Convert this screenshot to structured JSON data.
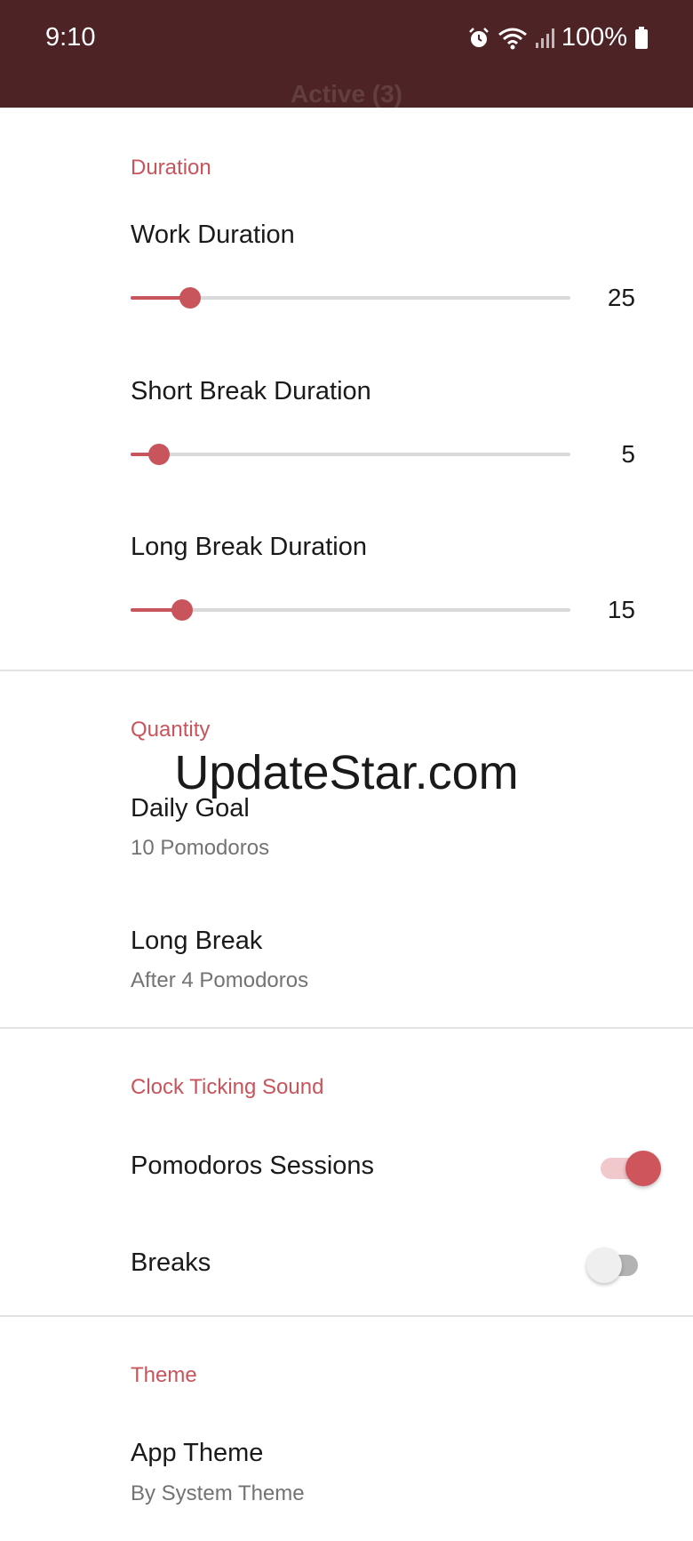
{
  "status_bar": {
    "time": "9:10",
    "battery": "100%"
  },
  "behind_title": "Active (3)",
  "duration": {
    "section_title": "Duration",
    "work": {
      "label": "Work Duration",
      "value": "25",
      "fraction": 0.135
    },
    "short_break": {
      "label": "Short Break Duration",
      "value": "5",
      "fraction": 0.065
    },
    "long_break": {
      "label": "Long Break Duration",
      "value": "15",
      "fraction": 0.118
    }
  },
  "quantity": {
    "section_title": "Quantity",
    "daily_goal": {
      "title": "Daily Goal",
      "summary": "10 Pomodoros"
    },
    "long_break": {
      "title": "Long Break",
      "summary": "After 4 Pomodoros"
    }
  },
  "watermark": "UpdateStar.com",
  "clock_ticking_sound": {
    "section_title": "Clock Ticking Sound",
    "pomodoros_sessions": {
      "label": "Pomodoros Sessions",
      "on": true
    },
    "breaks": {
      "label": "Breaks",
      "on": false
    }
  },
  "theme": {
    "section_title": "Theme",
    "app_theme": {
      "title": "App Theme",
      "summary": "By System Theme"
    }
  },
  "colors": {
    "accent": "#c8545c",
    "status_bar": "#4e2326"
  }
}
